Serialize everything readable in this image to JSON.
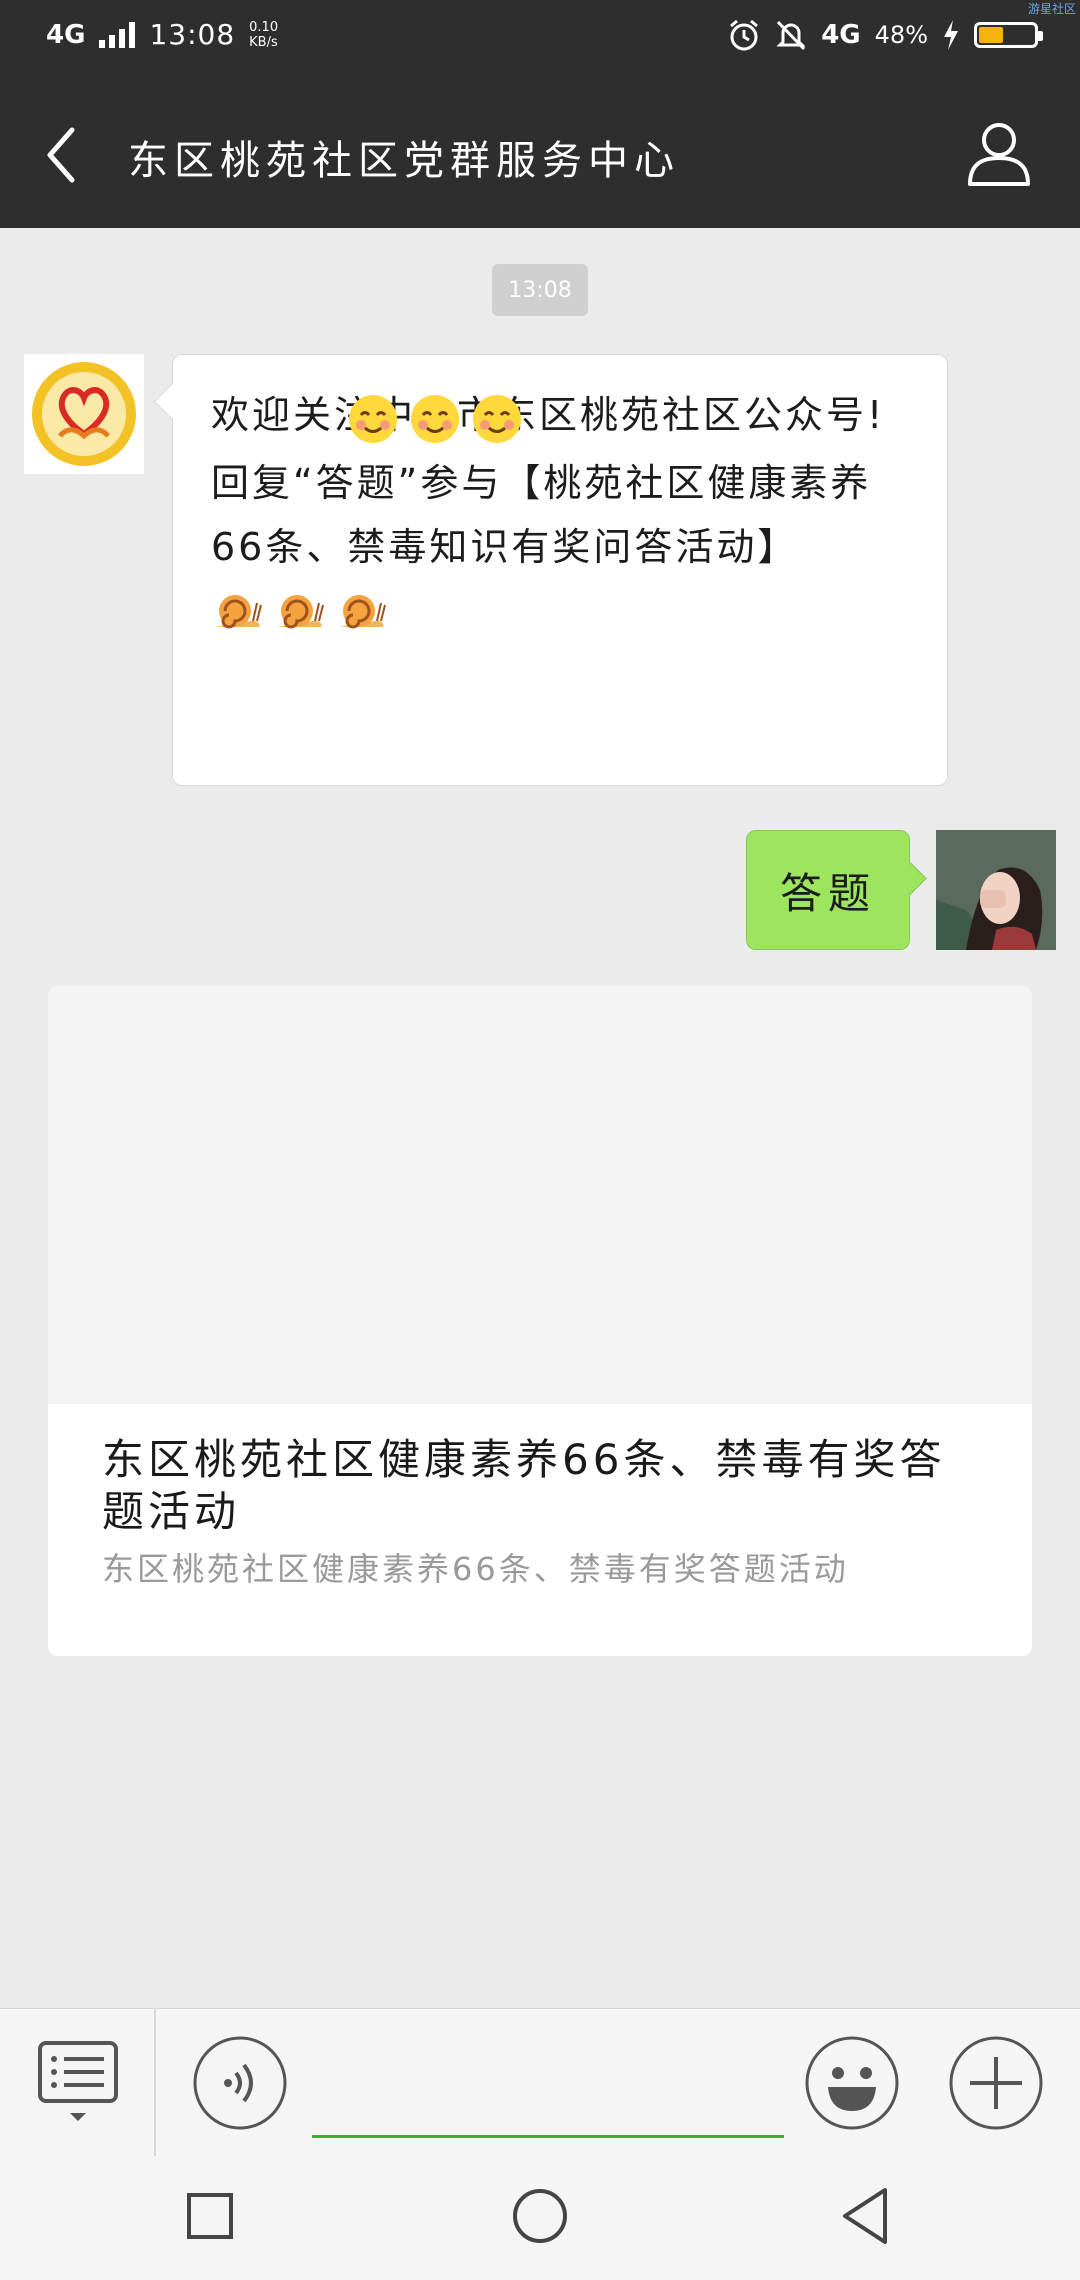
{
  "status_bar": {
    "network": "4G",
    "time": "13:08",
    "speed_value": "0.10",
    "speed_unit": "KB/s",
    "network_right": "4G",
    "battery_percent": "48%",
    "battery_level": 0.48,
    "corner_tag": "游星社区"
  },
  "header": {
    "title": "东区桃苑社区党群服务中心",
    "back_icon": "chevron-left-icon",
    "profile_icon": "person-icon"
  },
  "chat": {
    "timestamp": "13:08",
    "messages": [
      {
        "sender": "official",
        "line1": "欢迎关注中山市东区桃苑社区公众号!",
        "line2": "回复“答题”参与【桃苑社区健康素养66条、禁毒知识有奖问答活动】",
        "emojis_row1": [
          "smile-icon",
          "smile-icon",
          "smile-icon"
        ],
        "emojis_row2": [
          "snail-icon",
          "snail-icon",
          "snail-icon"
        ]
      },
      {
        "sender": "user",
        "text": "答题"
      }
    ],
    "card": {
      "title": "东区桃苑社区健康素养66条、禁毒有奖答题活动",
      "description": "东区桃苑社区健康素养66条、禁毒有奖答题活动"
    }
  },
  "input_bar": {
    "placeholder": "",
    "menu_icon": "menu-list-icon",
    "voice_icon": "voice-icon",
    "emoji_icon": "emoji-icon",
    "plus_icon": "plus-icon"
  },
  "colors": {
    "header_bg": "#2e2e2e",
    "chat_bg": "#ebebeb",
    "user_bubble": "#9de55f",
    "input_underline": "#3cb035",
    "battery_fill": "#f5b30b"
  }
}
